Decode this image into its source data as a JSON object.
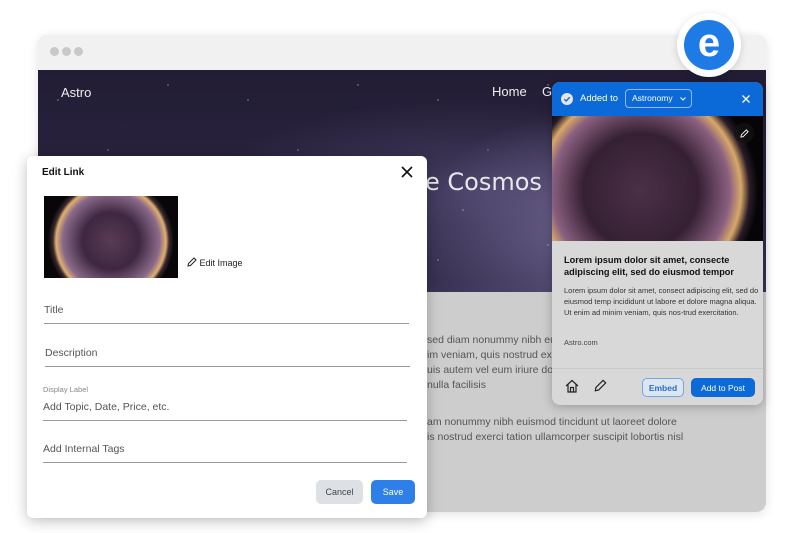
{
  "site": {
    "brand": "Astro",
    "nav": [
      "Home",
      "Ga"
    ],
    "hero_title": "e Cosmos",
    "body_lines": [
      "sed diam nonummy nibh euismod",
      "im veniam, quis nostrud exerci",
      "uis autem vel eum iriure dolor",
      "nulla facilisis"
    ],
    "body_lines2": [
      "am nonummy nibh euismod tincidunt ut laoreet dolore",
      "is nostrud exerci tation ullamcorper suscipit lobortis nisl"
    ]
  },
  "badge": {
    "letter": "e"
  },
  "dialog": {
    "title": "Edit Link",
    "edit_image": "Edit Image",
    "title_placeholder": "Title",
    "description_placeholder": "Description",
    "display_label": "Display Label",
    "display_placeholder": "Add Topic, Date, Price, etc.",
    "tags_placeholder": "Add Internal Tags",
    "cancel": "Cancel",
    "save": "Save"
  },
  "card": {
    "added_to": "Added to",
    "collection": "Astronomy",
    "title": "Lorem ipsum dolor sit amet, consecte adipiscing elit, sed do eiusmod tempor",
    "description": "Lorem ipsum dolor sit amet, consect adipiscing elit, sed do eiusmod temp incididunt ut labore et dolore magna aliqua. Ut enim ad minim veniam, quis nos-trud exercitation.",
    "source": "Astro.com",
    "embed": "Embed",
    "add_to_post": "Add to Post"
  },
  "colors": {
    "accent": "#0b6ad8",
    "save": "#2f7fe8"
  }
}
